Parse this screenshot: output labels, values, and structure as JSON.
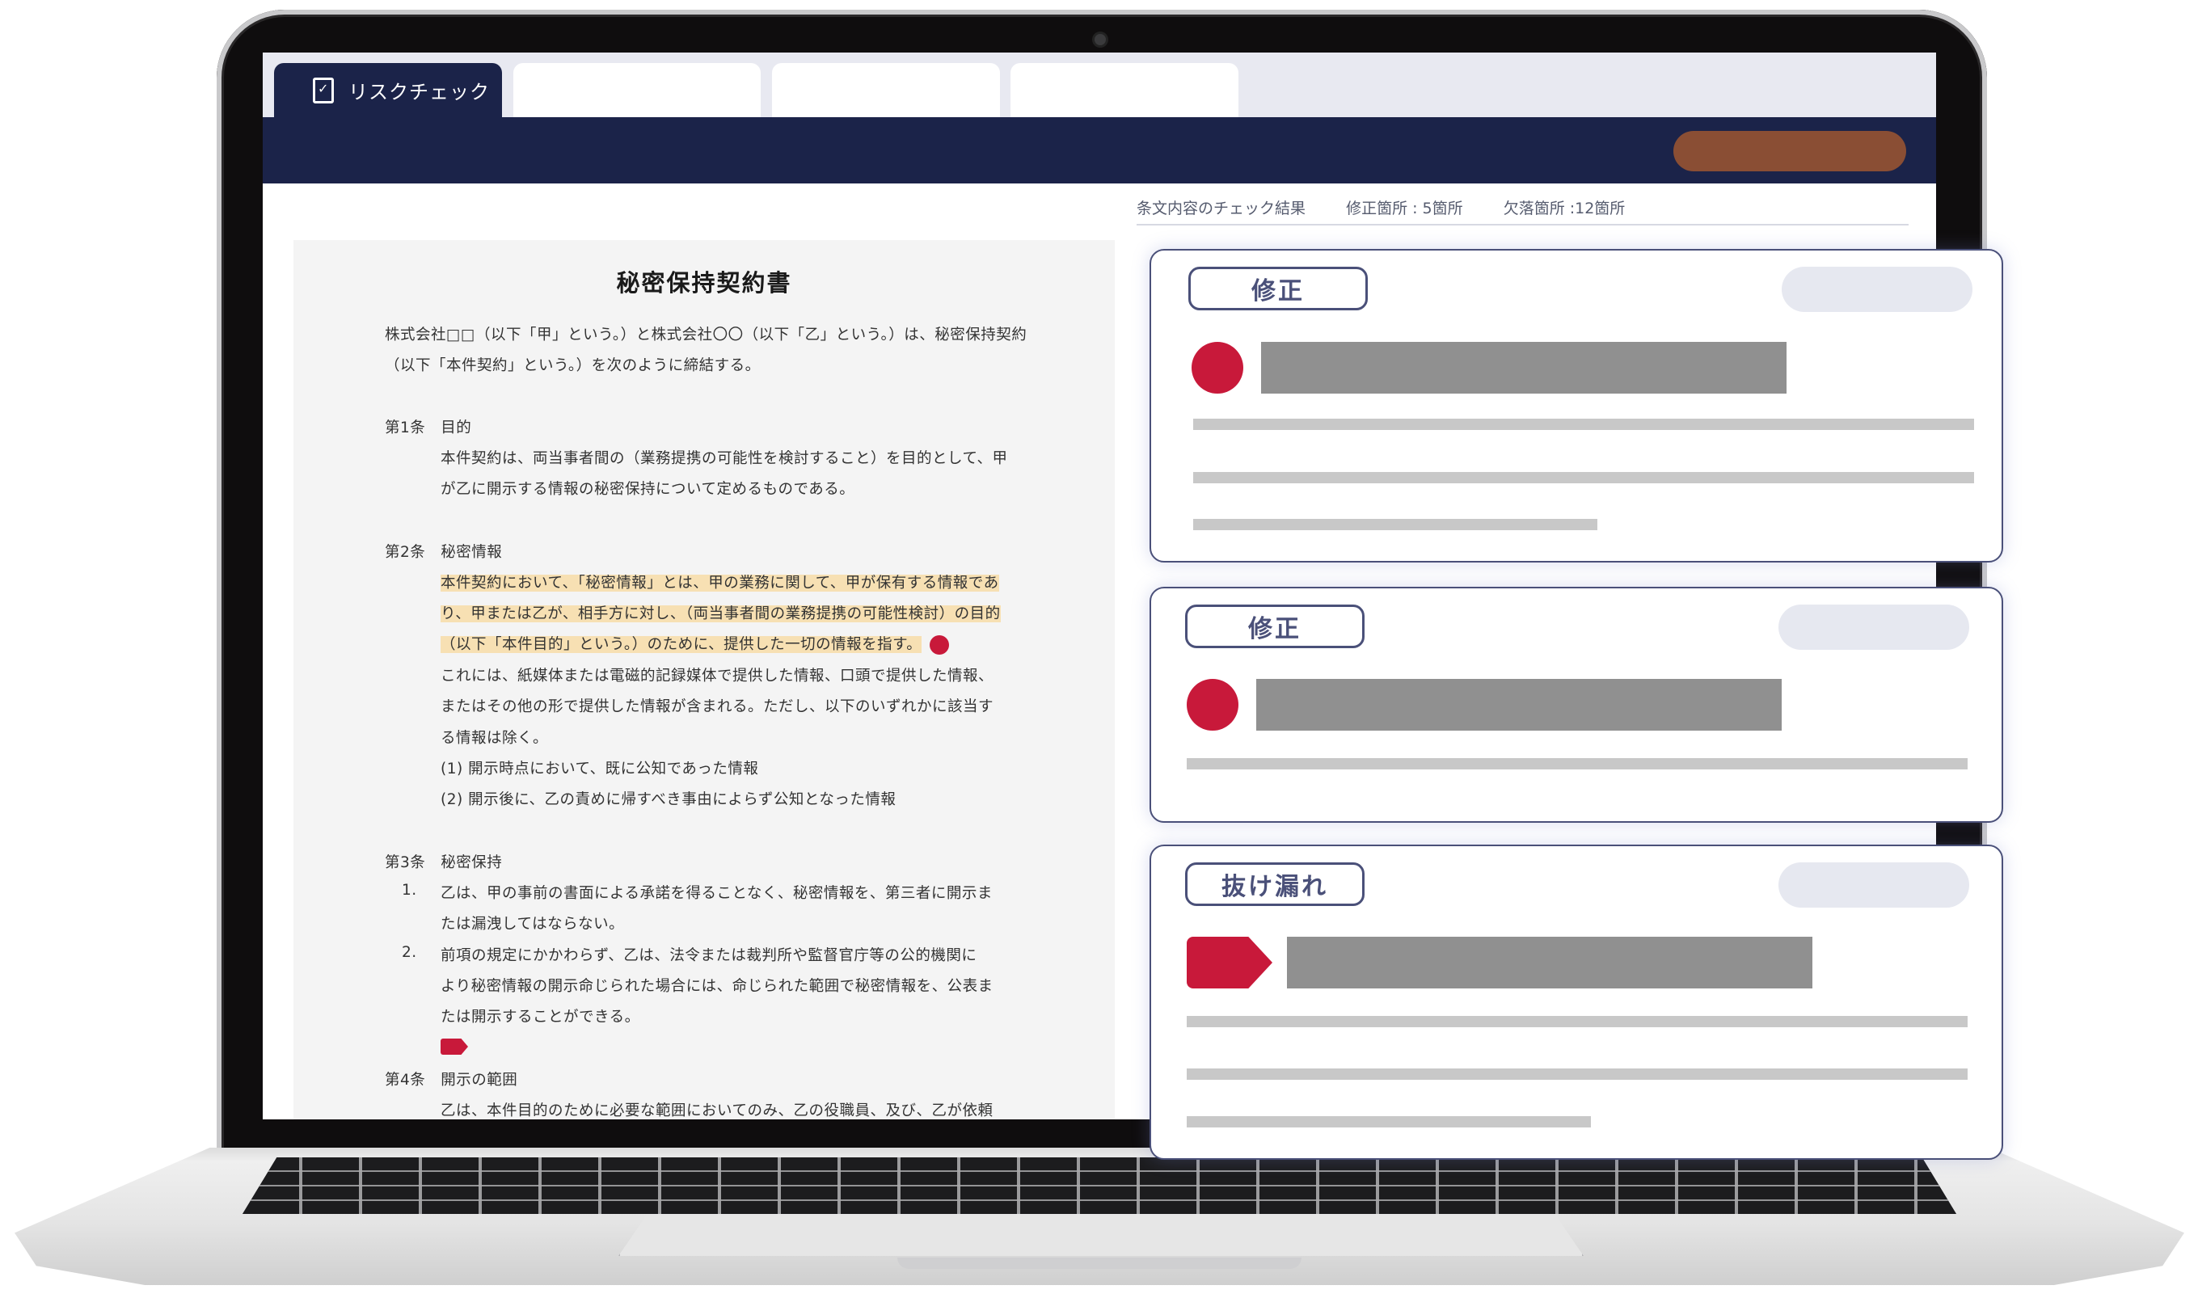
{
  "tabs": [
    {
      "label": "リスクチェック",
      "active": true
    },
    {
      "label": ""
    },
    {
      "label": ""
    },
    {
      "label": ""
    }
  ],
  "results": {
    "title": "条文内容のチェック結果",
    "modified": "修正箇所 : 5箇所",
    "missing": "欠落箇所 :12箇所"
  },
  "document": {
    "title": "秘密保持契約書",
    "lines": [
      "株式会社□□（以下「甲」という。）と株式会社〇〇（以下「乙」という。）は、秘密保持契約",
      "（以下「本件契約」という。）を次のように締結する。",
      "第1条　目的",
      "本件契約は、両当事者間の（業務提携の可能性を検討すること）を目的として、甲",
      "が乙に開示する情報の秘密保持について定めるものである。",
      "第2条　秘密情報",
      "本件契約において、「秘密情報」とは、甲の業務に関して、甲が保有する情報であ",
      "り、甲または乙が、相手方に対し、（両当事者間の業務提携の可能性検討）の目的",
      "（以下「本件目的」という。）のために、提供した一切の情報を指す。",
      "これには、紙媒体または電磁的記録媒体で提供した情報、口頭で提供した情報、",
      "またはその他の形で提供した情報が含まれる。ただし、以下のいずれかに該当す",
      "る情報は除く。",
      "(1) 開示時点において、既に公知であった情報",
      "(2) 開示後に、乙の責めに帰すべき事由によらず公知となった情報",
      "第3条　秘密保持",
      "1.",
      "乙は、甲の事前の書面による承諾を得ることなく、秘密情報を、第三者に開示ま",
      "たは漏洩してはならない。",
      "2.",
      "前項の規定にかかわらず、乙は、法令または裁判所や監督官庁等の公的機関に",
      "より秘密情報の開示命じられた場合には、命じられた範囲で秘密情報を、公表ま",
      "たは開示することができる。",
      "第4条　開示の範囲",
      "乙は、本件目的のために必要な範囲においてのみ、乙の役職員、及び、乙が依頼"
    ]
  },
  "cards": [
    {
      "badge": "修正",
      "marker": "dot"
    },
    {
      "badge": "修正",
      "marker": "dot"
    },
    {
      "badge": "抜け漏れ",
      "marker": "tag"
    }
  ],
  "colors": {
    "navy": "#1b2349",
    "accent_brown": "#8a4e34",
    "marker_red": "#c8193a",
    "highlight": "#f7e0b3"
  },
  "icons": {
    "tab": "document-check-icon"
  }
}
